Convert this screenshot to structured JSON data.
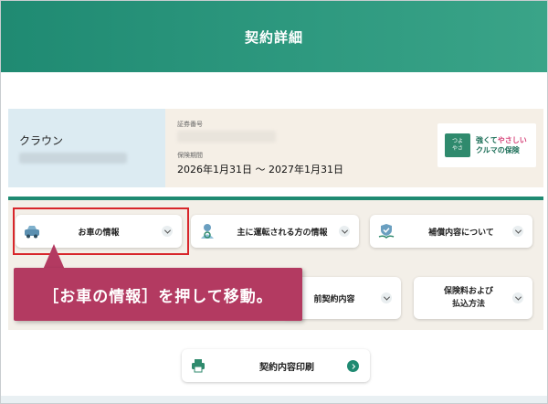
{
  "header": {
    "title": "契約詳細"
  },
  "vehicle": {
    "name": "クラウン",
    "certificate_label": "証券番号",
    "period_label": "保険期間",
    "period_value": "2026年1月31日 ～ 2027年1月31日"
  },
  "brand": {
    "mark_lines": [
      "つよ",
      "やさ"
    ],
    "line1_a": "強くて",
    "line1_b": "やさしい",
    "line2": "クルマの保険"
  },
  "menu": {
    "car_info": "お車の情報",
    "driver_info": "主に運転される方の情報",
    "coverage": "補償内容について",
    "previous_contract": "前契約内容",
    "fee_line1": "保険料および",
    "fee_line2": "払込方法"
  },
  "callout": {
    "text": "［お車の情報］を押して移動。"
  },
  "print": {
    "label": "契約内容印刷"
  },
  "colors": {
    "header": "#1f8a72",
    "callout": "#b33a61",
    "highlight": "#d8262b"
  }
}
